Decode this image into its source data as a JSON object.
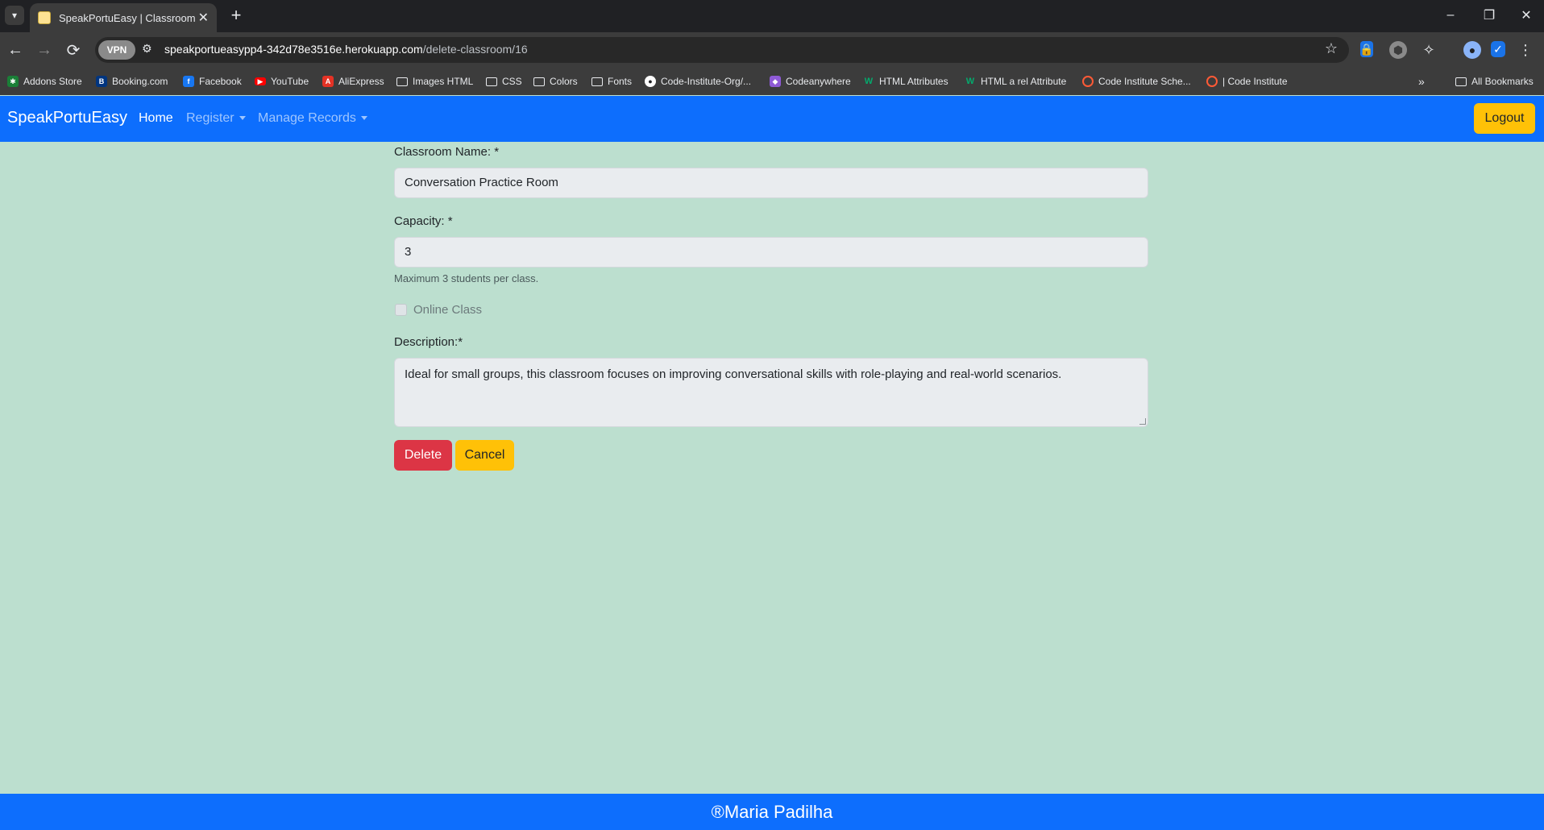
{
  "browser": {
    "tab_title": "SpeakPortuEasy | Classroom Re",
    "url_host": "speakportueasypp4-342d78e3516e.herokuapp.com",
    "url_path": "/delete-classroom/16",
    "vpn_label": "VPN",
    "bookmarks": [
      {
        "label": "Addons Store",
        "icon": "puzzle-icon",
        "color": "#1a7f37"
      },
      {
        "label": "Booking.com",
        "icon": "booking-icon",
        "color": "#003580"
      },
      {
        "label": "Facebook",
        "icon": "facebook-icon",
        "color": "#1877f2"
      },
      {
        "label": "YouTube",
        "icon": "youtube-icon",
        "color": "#ff0000"
      },
      {
        "label": "AliExpress",
        "icon": "aliexpress-icon",
        "color": "#e43225"
      },
      {
        "label": "Images HTML",
        "icon": "folder-icon"
      },
      {
        "label": "CSS",
        "icon": "folder-icon"
      },
      {
        "label": "Colors",
        "icon": "folder-icon"
      },
      {
        "label": "Fonts",
        "icon": "folder-icon"
      },
      {
        "label": "Code-Institute-Org/...",
        "icon": "github-icon",
        "color": "#ffffff"
      },
      {
        "label": "Codeanywhere",
        "icon": "codeanywhere-icon",
        "color": "#8e5ad6"
      },
      {
        "label": "HTML Attributes",
        "icon": "w3-icon",
        "color": "#04aa6d"
      },
      {
        "label": "HTML a rel Attribute",
        "icon": "w3-icon",
        "color": "#04aa6d"
      },
      {
        "label": "Code Institute Sche...",
        "icon": "code-institute-icon",
        "color": "#ff5a36"
      },
      {
        "label": "| Code Institute",
        "icon": "code-institute-icon",
        "color": "#ff5a36"
      }
    ],
    "all_bookmarks": "All Bookmarks"
  },
  "navbar": {
    "brand": "SpeakPortuEasy",
    "home": "Home",
    "register": "Register",
    "manage_records": "Manage Records",
    "logout": "Logout"
  },
  "form": {
    "classroom_name_label": "Classroom Name: *",
    "classroom_name_value": "Conversation Practice Room",
    "capacity_label": "Capacity: *",
    "capacity_value": "3",
    "capacity_help": "Maximum 3 students per class.",
    "online_label": "Online Class",
    "description_label": "Description:*",
    "description_value": "Ideal for small groups, this classroom focuses on improving conversational skills with role-playing and real-world scenarios.",
    "delete_button": "Delete",
    "cancel_button": "Cancel"
  },
  "footer": {
    "text": "®Maria Padilha"
  },
  "colors": {
    "primary": "#0d6efd",
    "page_bg": "#bcdfcf",
    "danger": "#dc3545",
    "warning": "#ffc107"
  }
}
